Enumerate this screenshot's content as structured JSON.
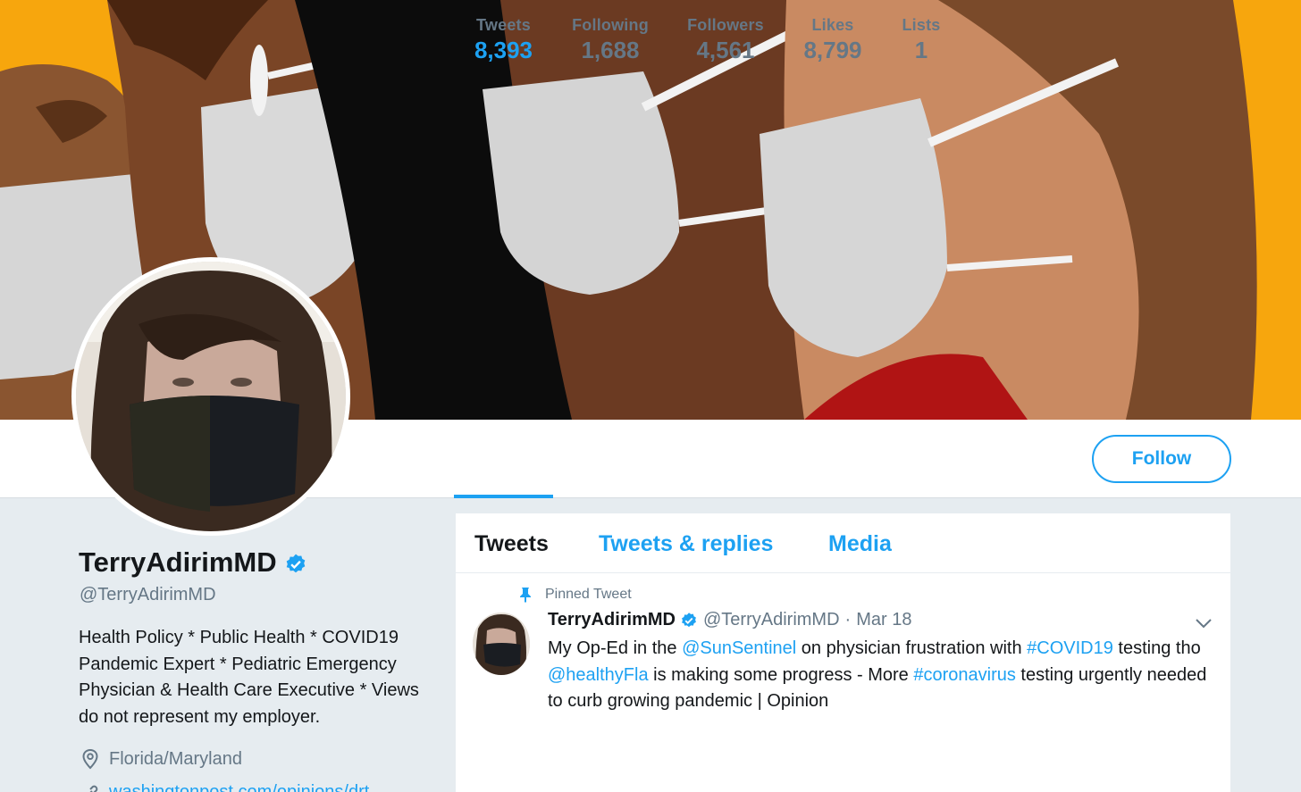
{
  "banner": {
    "description_icon": "masked-people-illustration"
  },
  "stats": [
    {
      "label": "Tweets",
      "value": "8,393",
      "active": true
    },
    {
      "label": "Following",
      "value": "1,688",
      "active": false
    },
    {
      "label": "Followers",
      "value": "4,561",
      "active": false
    },
    {
      "label": "Likes",
      "value": "8,799",
      "active": false
    },
    {
      "label": "Lists",
      "value": "1",
      "active": false
    }
  ],
  "follow_label": "Follow",
  "profile": {
    "name": "TerryAdirimMD",
    "handle": "@TerryAdirimMD",
    "bio": "Health Policy * Public Health * COVID19 Pandemic Expert * Pediatric Emergency Physician & Health Care Executive * Views do not represent my employer.",
    "location": "Florida/Maryland",
    "link_partial": "washingtonpost.com/opinions/drt..."
  },
  "tabs": [
    {
      "label": "Tweets",
      "active": true
    },
    {
      "label": "Tweets & replies",
      "active": false
    },
    {
      "label": "Media",
      "active": false
    }
  ],
  "tweet": {
    "pinned_label": "Pinned Tweet",
    "author": "TerryAdirimMD",
    "handle": "@TerryAdirimMD",
    "sep": "·",
    "date": "Mar 18",
    "t1": "My Op-Ed in the ",
    "m1": "@SunSentinel",
    "t2": " on physician frustration with ",
    "h1": "#COVID19",
    "t3": " testing tho ",
    "m2": "@healthyFla",
    "t4": " is making some progress - More ",
    "h2": "#coronavirus",
    "t5": " testing urgently needed to curb growing pandemic | Opinion"
  },
  "colors": {
    "accent": "#1da1f2",
    "banner_bg": "#f7a60d",
    "muted": "#657786"
  }
}
